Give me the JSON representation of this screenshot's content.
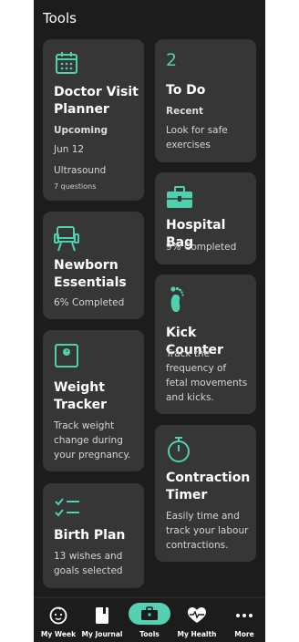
{
  "header": {
    "title": "Tools"
  },
  "cards": {
    "doctor": {
      "title": "Doctor Visit Planner",
      "subtitle": "Upcoming",
      "date": "Jun 12",
      "visit": "Ultrasound",
      "questions": "7 questions"
    },
    "todo": {
      "count": "2",
      "title": "To Do",
      "subtitle": "Recent",
      "text": "Look for safe exercises"
    },
    "hospital": {
      "title": "Hospital Bag",
      "text": "9% Completed"
    },
    "newborn": {
      "title": "Newborn Essentials",
      "text": "6% Completed"
    },
    "kick": {
      "title": "Kick Counter",
      "text": "Track the frequency of fetal movements and kicks."
    },
    "weight": {
      "title": "Weight Tracker",
      "text": "Track weight change during your pregnancy."
    },
    "contraction": {
      "title": "Contraction Timer",
      "text": "Easily time and track your labour contractions."
    },
    "birth": {
      "title": "Birth Plan",
      "text": "13 wishes and goals selected"
    }
  },
  "nav": {
    "items": [
      {
        "label": "My Week",
        "icon": "baby-face-icon"
      },
      {
        "label": "My Journal",
        "icon": "journal-icon"
      },
      {
        "label": "Tools",
        "icon": "toolbox-icon"
      },
      {
        "label": "My Health",
        "icon": "heart-pulse-icon"
      },
      {
        "label": "More",
        "icon": "more-dots-icon"
      }
    ],
    "active": "Tools"
  },
  "colors": {
    "accent": "#55d1b2",
    "card": "#363636",
    "background": "#1c1c1c"
  }
}
